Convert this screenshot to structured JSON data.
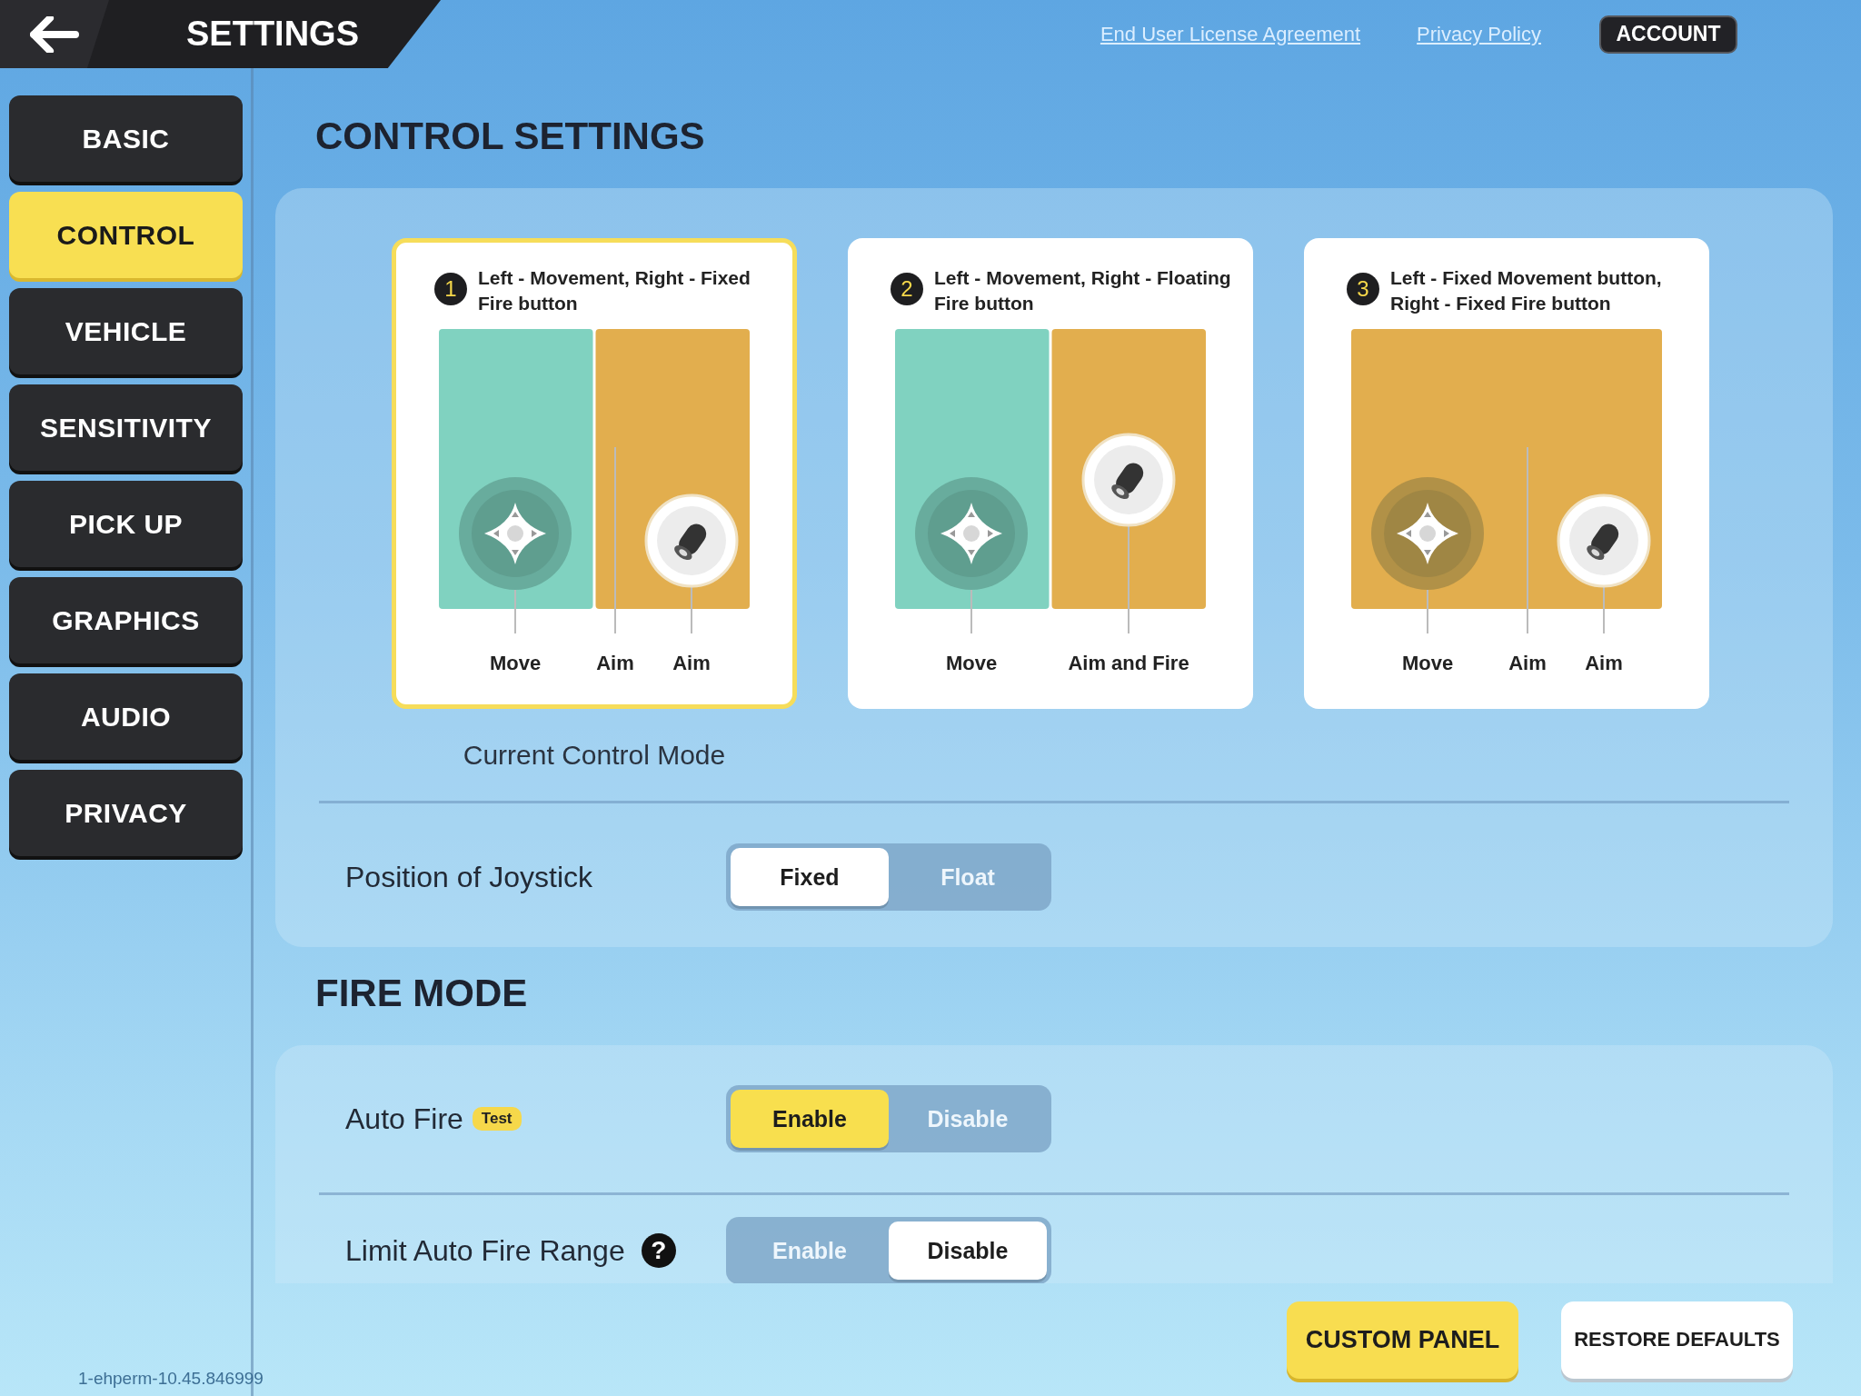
{
  "header": {
    "title": "SETTINGS"
  },
  "top_links": [
    {
      "label": "End User License Agreement"
    },
    {
      "label": "Privacy Policy"
    }
  ],
  "account_button": "ACCOUNT",
  "sidebar": {
    "items": [
      {
        "label": "BASIC",
        "selected": false
      },
      {
        "label": "CONTROL",
        "selected": true
      },
      {
        "label": "VEHICLE",
        "selected": false
      },
      {
        "label": "SENSITIVITY",
        "selected": false
      },
      {
        "label": "PICK UP",
        "selected": false
      },
      {
        "label": "GRAPHICS",
        "selected": false
      },
      {
        "label": "AUDIO",
        "selected": false
      },
      {
        "label": "PRIVACY",
        "selected": false
      }
    ]
  },
  "control_settings": {
    "title": "CONTROL SETTINGS",
    "modes": [
      {
        "number": "1",
        "title": "Left - Movement, Right - Fixed Fire button",
        "selected": true,
        "zones": [
          {
            "color": "#80d2c0"
          },
          {
            "color": "#e2ae4e"
          }
        ],
        "controls": [
          {
            "kind": "joystick",
            "label": "Move"
          },
          {
            "kind": "split",
            "label": "Aim"
          },
          {
            "kind": "fire",
            "label": "Aim"
          }
        ]
      },
      {
        "number": "2",
        "title": "Left - Movement, Right - Floating Fire button",
        "selected": false,
        "zones": [
          {
            "color": "#80d2c0"
          },
          {
            "color": "#e2ae4e"
          }
        ],
        "controls": [
          {
            "kind": "joystick",
            "label": "Move"
          },
          {
            "kind": "floating_fire",
            "label": "Aim and Fire"
          }
        ]
      },
      {
        "number": "3",
        "title": "Left - Fixed Movement button, Right - Fixed Fire button",
        "selected": false,
        "zones": [
          {
            "color": "#e2ae4e"
          }
        ],
        "controls": [
          {
            "kind": "joystick",
            "label": "Move"
          },
          {
            "kind": "split",
            "label": "Aim"
          },
          {
            "kind": "fire",
            "label": "Aim"
          }
        ]
      }
    ],
    "current_mode_caption": "Current Control Mode",
    "rows": [
      {
        "label": "Position of Joystick",
        "options": [
          {
            "label": "Fixed",
            "selected": true
          },
          {
            "label": "Float",
            "selected": false
          }
        ],
        "kind": "plain"
      }
    ]
  },
  "fire_mode": {
    "title": "FIRE MODE",
    "rows": [
      {
        "label": "Auto Fire",
        "badge": "Test",
        "options": [
          {
            "label": "Enable",
            "selected": true
          },
          {
            "label": "Disable",
            "selected": false
          }
        ],
        "kind": "highlight"
      },
      {
        "label": "Limit Auto Fire Range",
        "help": "?",
        "options": [
          {
            "label": "Enable",
            "selected": false
          },
          {
            "label": "Disable",
            "selected": true
          }
        ],
        "kind": "plain"
      }
    ]
  },
  "bottom_buttons": [
    {
      "label": "CUSTOM PANEL",
      "kind": "primary"
    },
    {
      "label": "RESTORE DEFAULTS",
      "kind": "secondary"
    }
  ],
  "version": "1-ehperm-10.45.846999"
}
